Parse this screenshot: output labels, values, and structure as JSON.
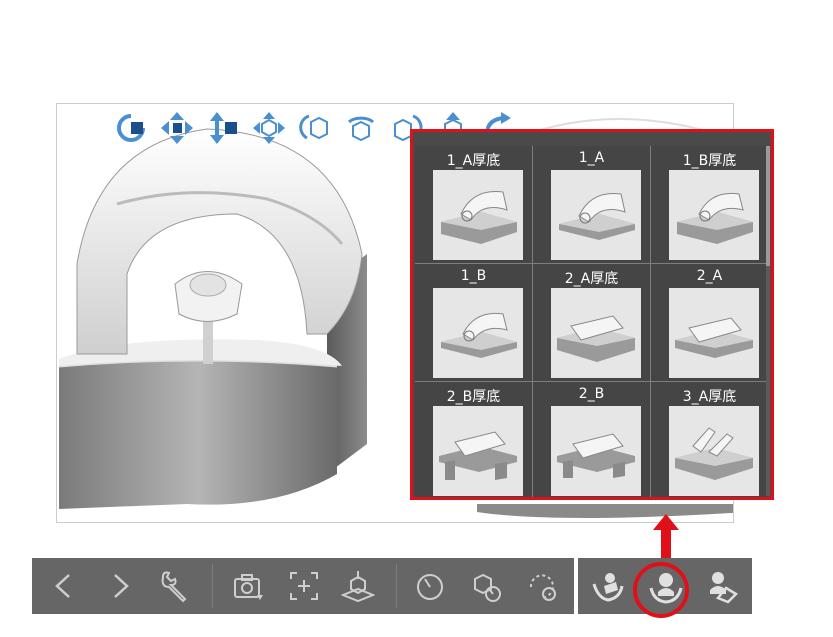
{
  "viewport": {
    "tools": [
      {
        "icon": "camera-rotate-icon"
      },
      {
        "icon": "move-horizontal-icon"
      },
      {
        "icon": "move-vertical-icon"
      },
      {
        "icon": "move-all-icon"
      },
      {
        "icon": "rotate-object-icon"
      },
      {
        "icon": "rotate-x-icon"
      },
      {
        "icon": "rotate-y-icon"
      },
      {
        "icon": "scale-icon"
      },
      {
        "icon": "reset-icon"
      }
    ]
  },
  "material_panel": {
    "items": [
      {
        "label": "1_A厚底"
      },
      {
        "label": "1_A"
      },
      {
        "label": "1_B厚底"
      },
      {
        "label": "1_B"
      },
      {
        "label": "2_A厚底"
      },
      {
        "label": "2_A"
      },
      {
        "label": "2_B厚底"
      },
      {
        "label": "2_B"
      },
      {
        "label": "3_A厚底"
      }
    ]
  },
  "bottom_toolbar": {
    "buttons": [
      {
        "icon": "chevron-left-icon"
      },
      {
        "icon": "chevron-right-icon"
      },
      {
        "icon": "wrench-icon"
      },
      {
        "icon": "camera-icon"
      },
      {
        "icon": "fit-view-icon"
      },
      {
        "icon": "ground-icon"
      },
      {
        "icon": "timer-icon"
      },
      {
        "icon": "object-timer-icon"
      },
      {
        "icon": "rotate-timer-icon"
      },
      {
        "icon": "pose-hand-icon"
      },
      {
        "icon": "material-hand-icon"
      },
      {
        "icon": "preset-hand-icon"
      }
    ],
    "highlighted": "material-hand-icon"
  },
  "colors": {
    "highlight": "#e0101a",
    "toolbar_bg": "#666666",
    "panel_bg": "#4a4a4a",
    "tool_blue": "#4a8fd0"
  }
}
